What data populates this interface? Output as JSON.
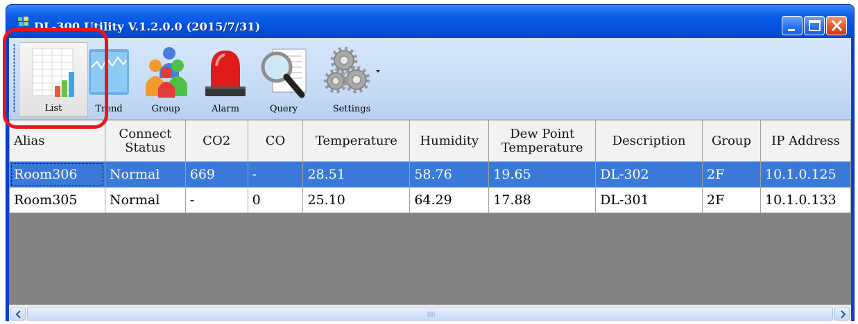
{
  "window": {
    "title": "DL-300 Utility V.1.2.0.0 (2015/7/31)"
  },
  "toolbar": {
    "buttons": [
      {
        "label": "List",
        "icon": "list-icon"
      },
      {
        "label": "Trend",
        "icon": "trend-icon"
      },
      {
        "label": "Group",
        "icon": "group-icon"
      },
      {
        "label": "Alarm",
        "icon": "alarm-icon"
      },
      {
        "label": "Query",
        "icon": "query-icon"
      },
      {
        "label": "Settings",
        "icon": "settings-icon"
      }
    ]
  },
  "table": {
    "columns": [
      [
        "Alias"
      ],
      [
        "Connect",
        "Status"
      ],
      [
        "CO2"
      ],
      [
        "CO"
      ],
      [
        "Temperature"
      ],
      [
        "Humidity"
      ],
      [
        "Dew Point",
        "Temperature"
      ],
      [
        "Description"
      ],
      [
        "Group"
      ],
      [
        "IP Address"
      ]
    ],
    "rows": [
      [
        "Room306",
        "Normal",
        "669",
        "-",
        "28.51",
        "58.76",
        "19.65",
        "DL-302",
        "2F",
        "10.1.0.125"
      ],
      [
        "Room305",
        "Normal",
        "-",
        "0",
        "25.10",
        "64.29",
        "17.88",
        "DL-301",
        "2F",
        "10.1.0.133"
      ]
    ],
    "selected_row": 0
  },
  "colors": {
    "titlebar": "#0554e3",
    "selection": "#3b79d8",
    "highlight_ring": "#e8161b",
    "grid_background": "#838383"
  }
}
